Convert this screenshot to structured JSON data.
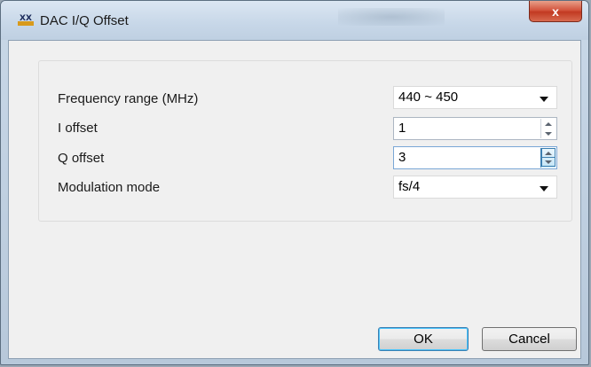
{
  "window": {
    "title": "DAC I/Q Offset",
    "close_glyph": "x",
    "icon": "app-logo-icon"
  },
  "form": {
    "fields": [
      {
        "label": "Frequency range (MHz)",
        "value": "440 ~ 450",
        "control": "dropdown"
      },
      {
        "label": "I offset",
        "value": "1",
        "control": "spinbox"
      },
      {
        "label": "Q offset",
        "value": "3",
        "control": "spinbox"
      },
      {
        "label": "Modulation mode",
        "value": "fs/4",
        "control": "dropdown"
      }
    ]
  },
  "buttons": {
    "ok_label": "OK",
    "cancel_label": "Cancel"
  },
  "colors": {
    "close_button": "#c9452b",
    "focus_accent": "#3c7fb1"
  }
}
